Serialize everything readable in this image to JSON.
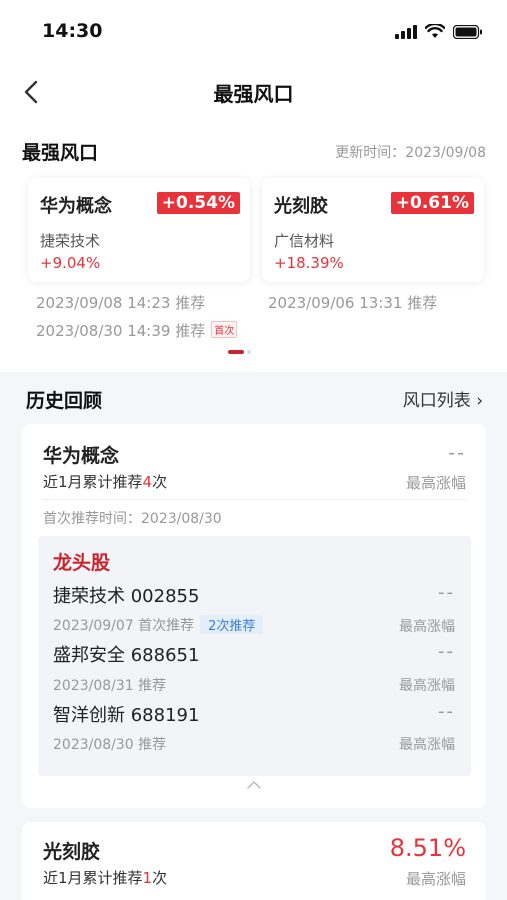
{
  "status_bar": {
    "time": "14:30"
  },
  "nav": {
    "title": "最强风口"
  },
  "top": {
    "title": "最强风口",
    "update_time": "更新时间：2023/09/08",
    "cards": [
      {
        "name": "华为概念",
        "change": "+0.54%",
        "stock": "捷荣技术",
        "stock_change": "+9.04%"
      },
      {
        "name": "光刻胶",
        "change": "+0.61%",
        "stock": "广信材料",
        "stock_change": "+18.39%"
      }
    ],
    "recs_left": [
      "2023/09/08 14:23 推荐",
      "2023/08/30 14:39 推荐"
    ],
    "first_tag": "首次",
    "recs_right": [
      "2023/09/06 13:31 推荐"
    ]
  },
  "history": {
    "title": "历史回顾",
    "list_link": "风口列表 ›",
    "cards": [
      {
        "name": "华为概念",
        "count_prefix": "近1月累计推荐",
        "count": "4",
        "count_suffix": "次",
        "value": "--",
        "value_label": "最高涨幅",
        "first_time": "首次推荐时间：2023/08/30",
        "leader_title": "龙头股",
        "stocks": [
          {
            "name": "捷荣技术 002855",
            "value": "--",
            "date": "2023/09/07 首次推荐",
            "tag": "2次推荐",
            "label": "最高涨幅"
          },
          {
            "name": "盛邦安全 688651",
            "value": "--",
            "date": "2023/08/31 推荐",
            "label": "最高涨幅"
          },
          {
            "name": "智洋创新 688191",
            "value": "--",
            "date": "2023/08/30 推荐",
            "label": "最高涨幅"
          }
        ]
      },
      {
        "name": "光刻胶",
        "count_prefix": "近1月累计推荐",
        "count": "1",
        "count_suffix": "次",
        "value": "8.51%",
        "value_label": "最高涨幅"
      }
    ]
  },
  "colors": {
    "accent_red": "#e8333b",
    "dark_red": "#c8252c",
    "tag_blue": "#3c7fd6"
  }
}
